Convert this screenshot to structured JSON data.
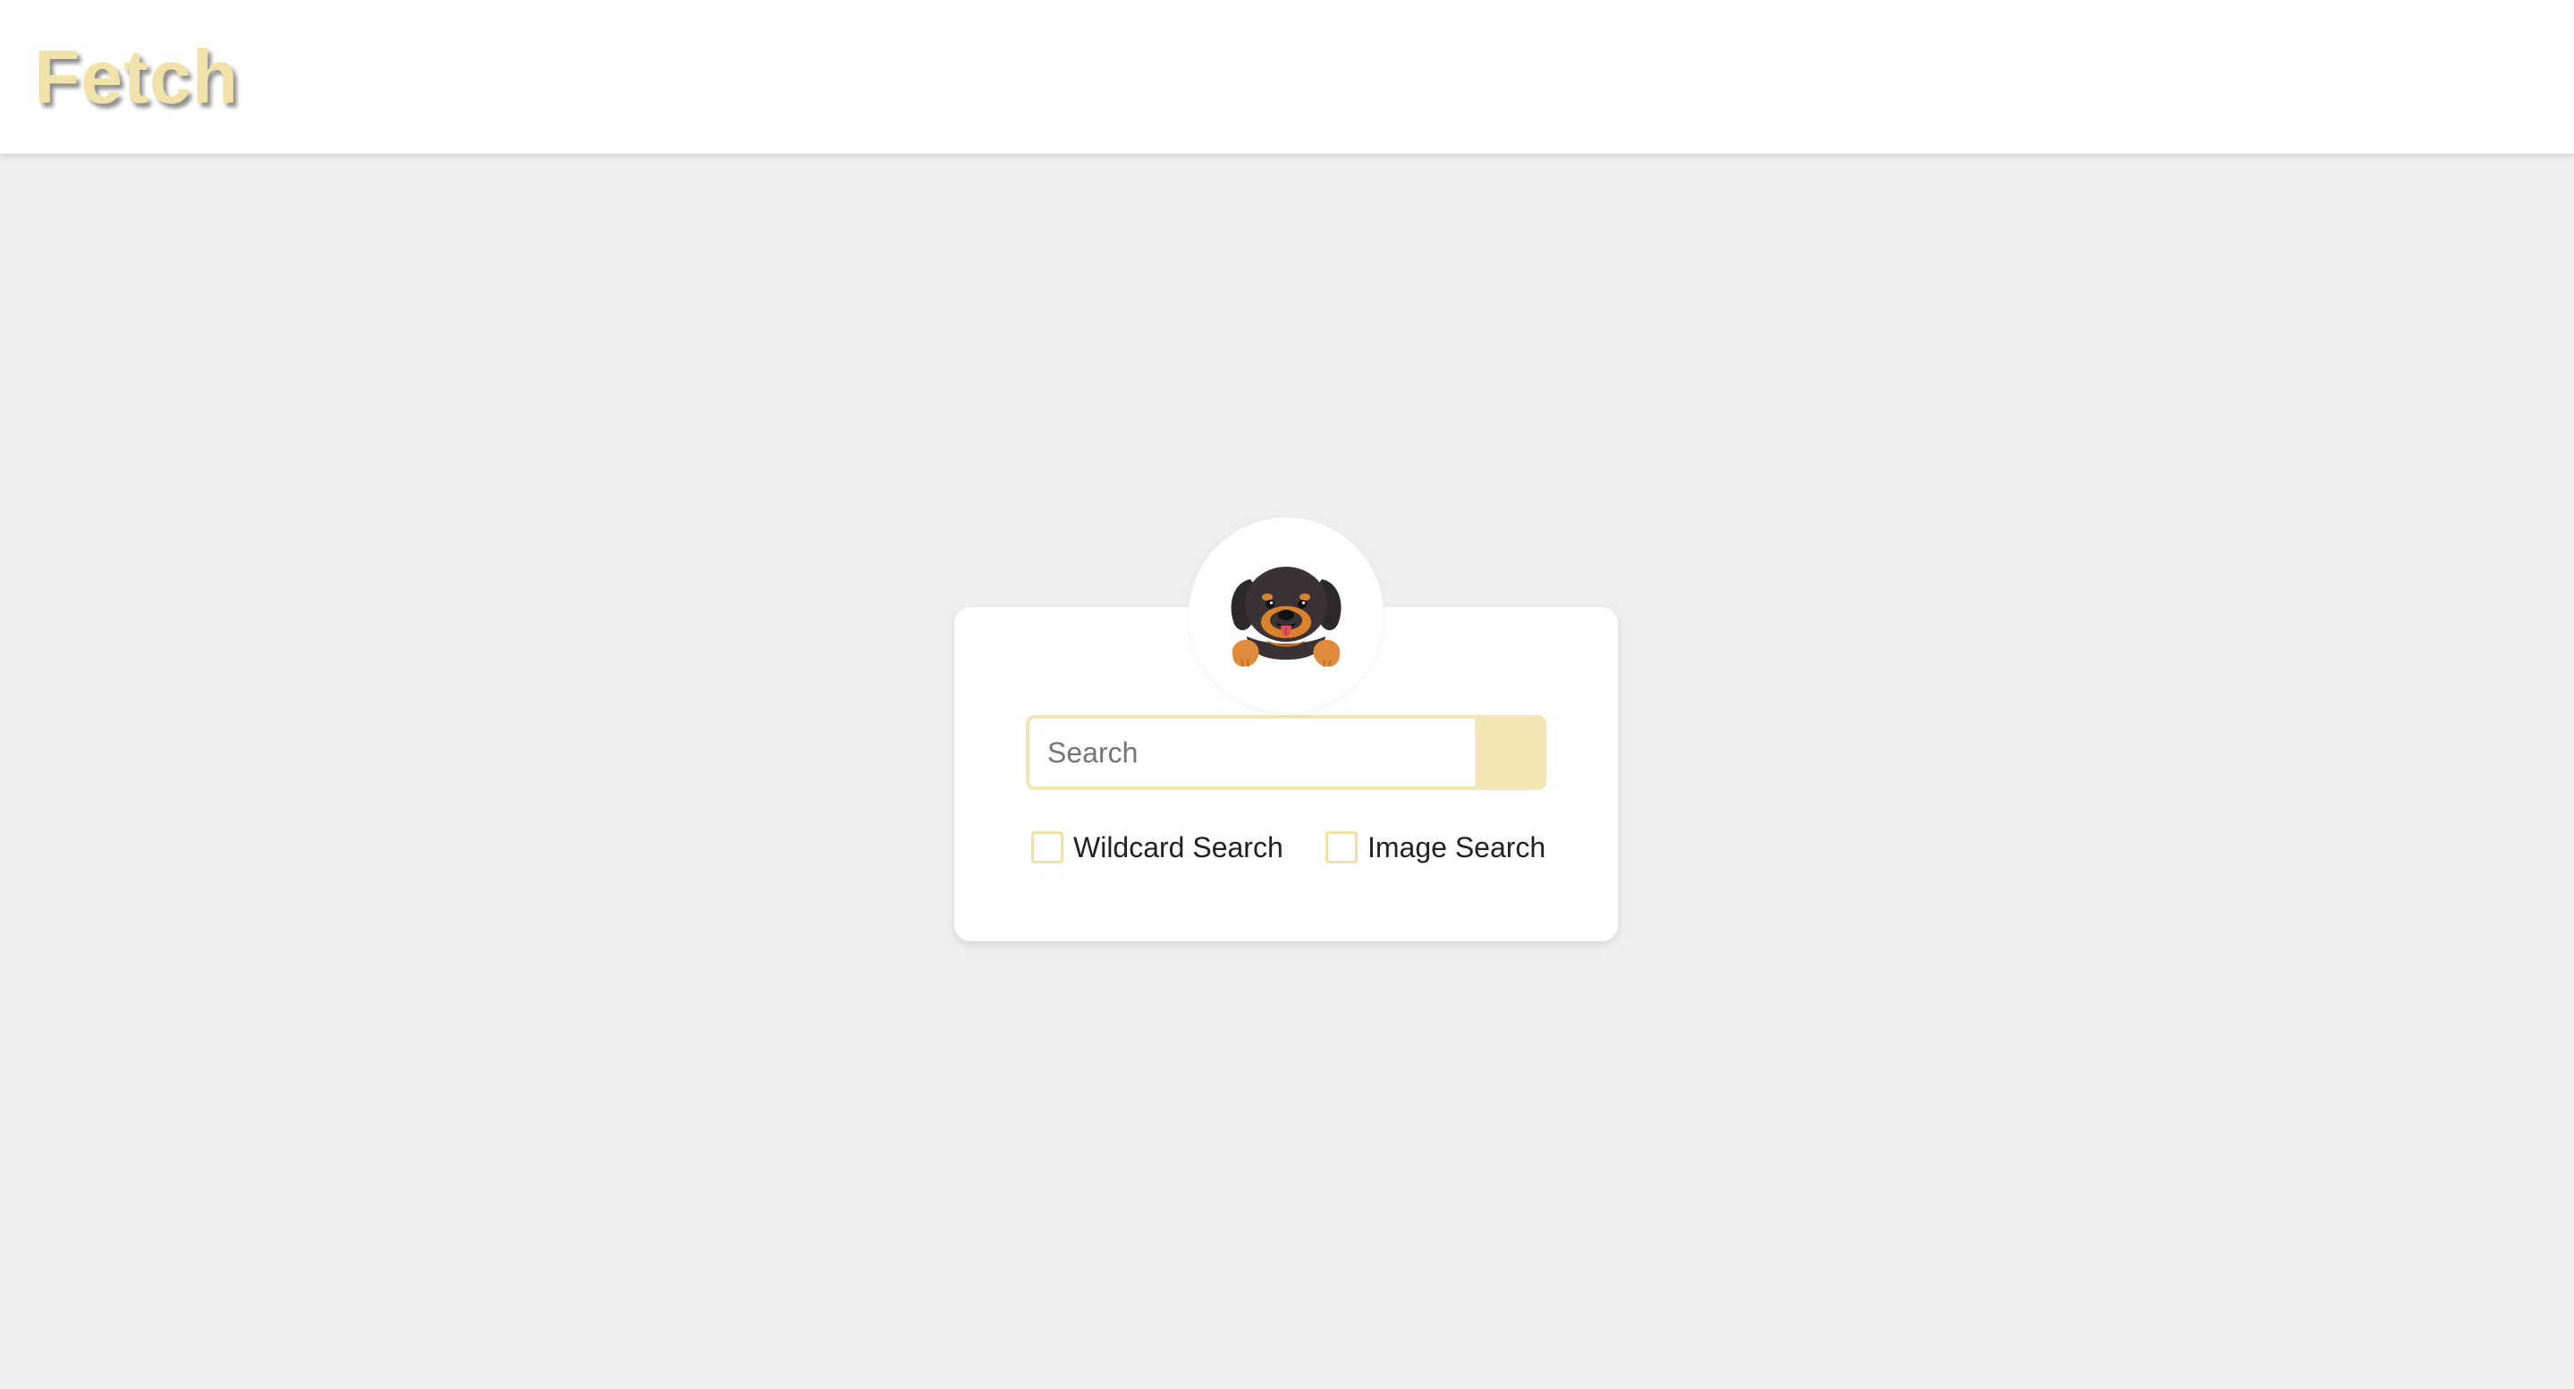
{
  "header": {
    "logo_text": "Fetch"
  },
  "search": {
    "placeholder": "Search",
    "value": "",
    "button_label": ""
  },
  "options": [
    {
      "label": "Wildcard Search",
      "checked": false
    },
    {
      "label": "Image Search",
      "checked": false
    }
  ],
  "icons": {
    "mascot": "dog-mascot-icon"
  },
  "colors": {
    "accent": "#f1e6b4",
    "logo": "#f1e3a8",
    "background": "#efefef",
    "card": "#ffffff",
    "dog_fur": "#3a3235",
    "dog_tan": "#d9822b",
    "dog_tongue": "#e0555b"
  }
}
